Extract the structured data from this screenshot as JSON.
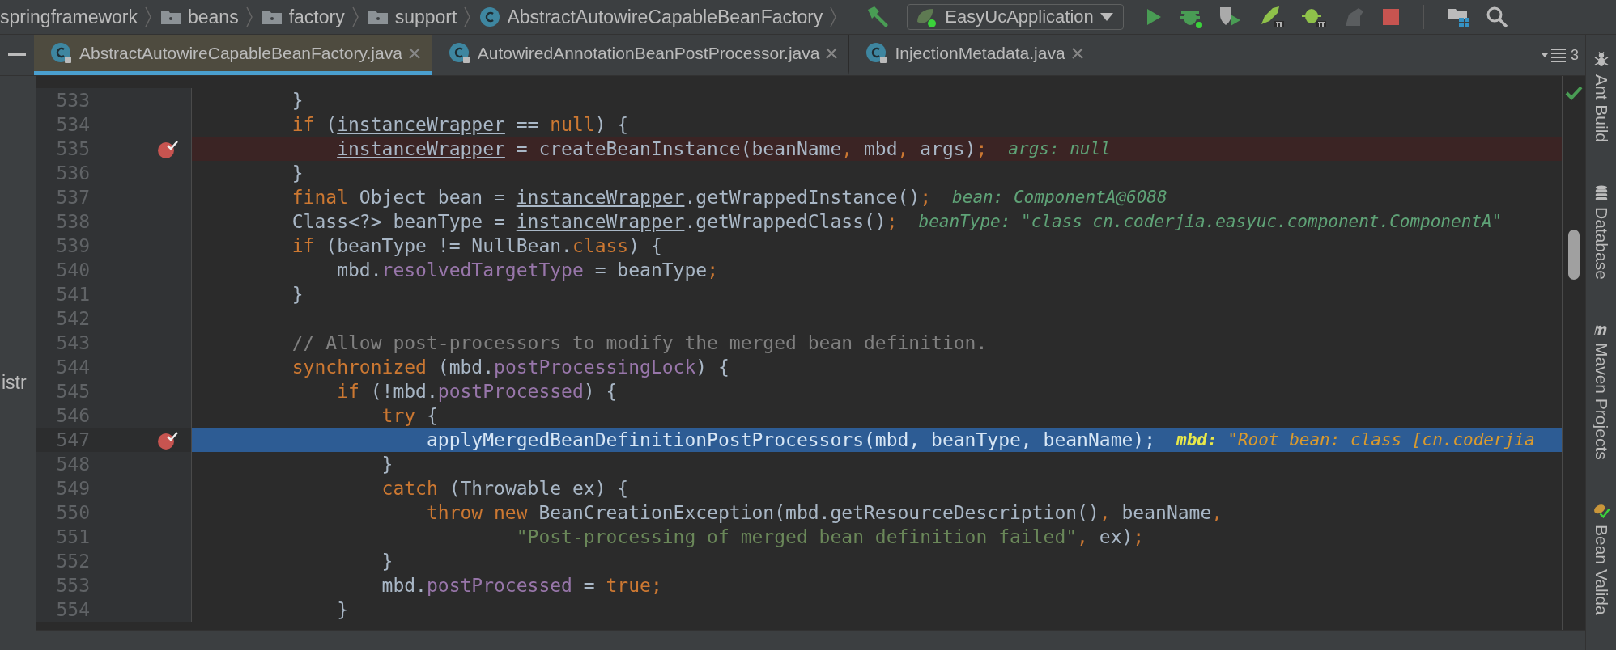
{
  "breadcrumbs": [
    {
      "kind": "none",
      "label": "springframework"
    },
    {
      "kind": "folder",
      "label": "beans"
    },
    {
      "kind": "folder",
      "label": "factory"
    },
    {
      "kind": "folder",
      "label": "support"
    },
    {
      "kind": "class",
      "label": "AbstractAutowireCapableBeanFactory"
    }
  ],
  "run_config": {
    "label": "EasyUcApplication"
  },
  "toolbar": [
    {
      "kind": "run",
      "disabled": false
    },
    {
      "kind": "debug",
      "disabled": false
    },
    {
      "kind": "coverage",
      "disabled": false
    },
    {
      "kind": "rocket",
      "disabled": false
    },
    {
      "kind": "bug",
      "disabled": false
    },
    {
      "kind": "profile",
      "disabled": true
    },
    {
      "kind": "stop",
      "disabled": false
    }
  ],
  "tabs": [
    {
      "label": "AbstractAutowireCapableBeanFactory.java",
      "selected": true
    },
    {
      "label": "AutowiredAnnotationBeanPostProcessor.java",
      "selected": false
    },
    {
      "label": "InjectionMetadata.java",
      "selected": false
    }
  ],
  "tab_count": "3",
  "left_panel_text": "istr",
  "lines": [
    {
      "number": "533",
      "breakpoint": false,
      "current": false,
      "segments": [
        {
          "kind": "plain",
          "text": "}"
        }
      ]
    },
    {
      "number": "534",
      "breakpoint": false,
      "current": false,
      "segments": [
        {
          "kind": "keyword",
          "text": "if"
        },
        {
          "kind": "plain",
          "text": " ("
        },
        {
          "kind": "var",
          "text": "instanceWrapper"
        },
        {
          "kind": "plain",
          "text": " == "
        },
        {
          "kind": "keyword",
          "text": "null"
        },
        {
          "kind": "plain",
          "text": ") {"
        }
      ],
      "children": [
        {
          "number": "535",
          "breakpoint": true,
          "current": false,
          "segments": [
            {
              "kind": "var",
              "text": "instanceWrapper"
            },
            {
              "kind": "plain",
              "text": " = createBeanInstance(beanName"
            },
            {
              "kind": "punct",
              "text": ","
            },
            {
              "kind": "plain",
              "text": " mbd"
            },
            {
              "kind": "punct",
              "text": ","
            },
            {
              "kind": "plain",
              "text": " args)"
            },
            {
              "kind": "punct",
              "text": ";"
            }
          ],
          "hint": {
            "label": "args:",
            "value": " null"
          }
        }
      ]
    },
    {
      "number": "536",
      "breakpoint": false,
      "current": false,
      "segments": [
        {
          "kind": "plain",
          "text": "}"
        }
      ]
    },
    {
      "number": "537",
      "breakpoint": false,
      "current": false,
      "segments": [
        {
          "kind": "keyword",
          "text": "final"
        },
        {
          "kind": "plain",
          "text": " Object bean = "
        },
        {
          "kind": "var",
          "text": "instanceWrapper"
        },
        {
          "kind": "plain",
          "text": ".getWrappedInstance()"
        },
        {
          "kind": "punct",
          "text": ";"
        }
      ],
      "hint": {
        "label": "bean:",
        "value": " ComponentA@6088"
      }
    },
    {
      "number": "538",
      "breakpoint": false,
      "current": false,
      "segments": [
        {
          "kind": "plain",
          "text": "Class<?> beanType = "
        },
        {
          "kind": "var",
          "text": "instanceWrapper"
        },
        {
          "kind": "plain",
          "text": ".getWrappedClass()"
        },
        {
          "kind": "punct",
          "text": ";"
        }
      ],
      "hint": {
        "label": "beanType:",
        "value": " \"class cn.coderjia.easyuc.component.ComponentA\""
      }
    },
    {
      "number": "539",
      "breakpoint": false,
      "current": false,
      "segments": [
        {
          "kind": "keyword",
          "text": "if"
        },
        {
          "kind": "plain",
          "text": " (beanType != NullBean."
        },
        {
          "kind": "keyword",
          "text": "class"
        },
        {
          "kind": "plain",
          "text": ") {"
        }
      ],
      "children": [
        {
          "number": "540",
          "breakpoint": false,
          "current": false,
          "segments": [
            {
              "kind": "plain",
              "text": "mbd."
            },
            {
              "kind": "field",
              "text": "resolvedTargetType"
            },
            {
              "kind": "plain",
              "text": " = beanType"
            },
            {
              "kind": "punct",
              "text": ";"
            }
          ]
        }
      ]
    },
    {
      "number": "541",
      "breakpoint": false,
      "current": false,
      "segments": [
        {
          "kind": "plain",
          "text": "}"
        }
      ]
    },
    {
      "number": "542",
      "breakpoint": false,
      "current": false
    },
    {
      "number": "543",
      "breakpoint": false,
      "current": false,
      "segments": [
        {
          "kind": "comment",
          "text": "// Allow post-processors to modify the merged bean definition."
        }
      ]
    },
    {
      "number": "544",
      "breakpoint": false,
      "current": false,
      "segments": [
        {
          "kind": "keyword",
          "text": "synchronized"
        },
        {
          "kind": "plain",
          "text": " (mbd."
        },
        {
          "kind": "field",
          "text": "postProcessingLock"
        },
        {
          "kind": "plain",
          "text": ") {"
        }
      ],
      "children": [
        {
          "number": "545",
          "breakpoint": false,
          "current": false,
          "segments": [
            {
              "kind": "keyword",
              "text": "if"
            },
            {
              "kind": "plain",
              "text": " (!mbd."
            },
            {
              "kind": "field",
              "text": "postProcessed"
            },
            {
              "kind": "plain",
              "text": ") {"
            }
          ],
          "children": [
            {
              "number": "546",
              "breakpoint": false,
              "current": false,
              "segments": [
                {
                  "kind": "keyword",
                  "text": "try"
                },
                {
                  "kind": "plain",
                  "text": " {"
                }
              ],
              "children": [
                {
                  "number": "547",
                  "breakpoint": true,
                  "current": true,
                  "segments": [
                    {
                      "kind": "plain",
                      "text": "applyMergedBeanDefinitionPostProcessors(mbd"
                    },
                    {
                      "kind": "punct",
                      "text": ","
                    },
                    {
                      "kind": "plain",
                      "text": " beanType"
                    },
                    {
                      "kind": "punct",
                      "text": ","
                    },
                    {
                      "kind": "plain",
                      "text": " beanName)"
                    },
                    {
                      "kind": "punct",
                      "text": ";"
                    }
                  ],
                  "hint": {
                    "label": "mbd:",
                    "value": " \"Root bean: class [cn.coderjia"
                  }
                }
              ]
            },
            {
              "number": "548",
              "breakpoint": false,
              "current": false,
              "segments": [
                {
                  "kind": "plain",
                  "text": "}"
                }
              ]
            },
            {
              "number": "549",
              "breakpoint": false,
              "current": false,
              "segments": [
                {
                  "kind": "keyword",
                  "text": "catch"
                },
                {
                  "kind": "plain",
                  "text": " (Throwable ex) {"
                }
              ],
              "children": [
                {
                  "number": "550",
                  "breakpoint": false,
                  "current": false,
                  "segments": [
                    {
                      "kind": "keyword",
                      "text": "throw new"
                    },
                    {
                      "kind": "plain",
                      "text": " BeanCreationException(mbd.getResourceDescription()"
                    },
                    {
                      "kind": "punct",
                      "text": ","
                    },
                    {
                      "kind": "plain",
                      "text": " beanName"
                    },
                    {
                      "kind": "punct",
                      "text": ","
                    }
                  ],
                  "children": [
                    {
                      "children": [
                        {
                          "number": "551",
                          "breakpoint": false,
                          "current": false,
                          "segments": [
                            {
                              "kind": "string",
                              "text": "\"Post-processing of merged bean definition failed\""
                            },
                            {
                              "kind": "punct",
                              "text": ","
                            },
                            {
                              "kind": "plain",
                              "text": " ex)"
                            },
                            {
                              "kind": "punct",
                              "text": ";"
                            }
                          ]
                        }
                      ]
                    }
                  ]
                }
              ]
            },
            {
              "number": "552",
              "breakpoint": false,
              "current": false,
              "segments": [
                {
                  "kind": "plain",
                  "text": "}"
                }
              ]
            },
            {
              "number": "553",
              "breakpoint": false,
              "current": false,
              "segments": [
                {
                  "kind": "plain",
                  "text": "mbd."
                },
                {
                  "kind": "field",
                  "text": "postProcessed"
                },
                {
                  "kind": "plain",
                  "text": " = "
                },
                {
                  "kind": "keyword",
                  "text": "true"
                },
                {
                  "kind": "punct",
                  "text": ";"
                }
              ]
            }
          ]
        },
        {
          "number": "554",
          "breakpoint": false,
          "current": false,
          "segments": [
            {
              "kind": "plain",
              "text": "}"
            }
          ]
        }
      ]
    }
  ],
  "tool_windows": [
    {
      "kind": "ant",
      "label": "Ant Build"
    },
    {
      "kind": "database",
      "label": "Database"
    },
    {
      "kind": "maven",
      "label": "Maven Projects"
    },
    {
      "kind": "bean",
      "label": "Bean Valida"
    }
  ]
}
